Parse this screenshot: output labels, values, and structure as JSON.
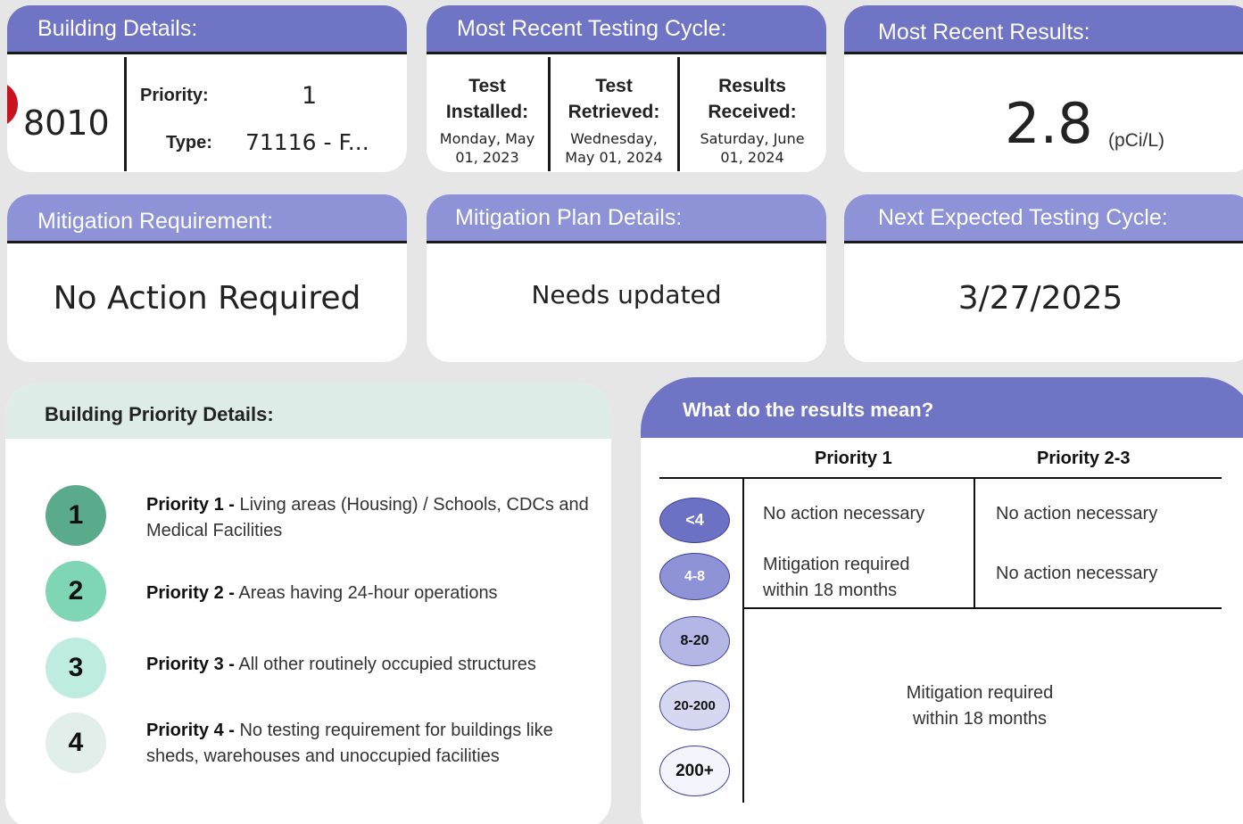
{
  "building": {
    "header": "Building Details:",
    "id": "8010",
    "priority_label": "Priority:",
    "priority_value": "1",
    "type_label": "Type:",
    "type_value": "71116 - F..."
  },
  "cycle": {
    "header": "Most Recent Testing Cycle:",
    "installed_label_1": "Test",
    "installed_label_2": "Installed:",
    "installed_date_1": "Monday, May",
    "installed_date_2": "01, 2023",
    "retrieved_label_1": "Test",
    "retrieved_label_2": "Retrieved:",
    "retrieved_date_1": "Wednesday,",
    "retrieved_date_2": "May 01, 2024",
    "received_label_1": "Results",
    "received_label_2": "Received:",
    "received_date_1": "Saturday, June",
    "received_date_2": "01, 2024"
  },
  "results": {
    "header": "Most Recent Results:",
    "value": "2.8",
    "unit": "(pCi/L)"
  },
  "mitigation_requirement": {
    "header": "Mitigation Requirement:",
    "value": "No Action Required"
  },
  "mitigation_plan": {
    "header": "Mitigation Plan Details:",
    "value": "Needs updated"
  },
  "next_cycle": {
    "header": "Next Expected Testing Cycle:",
    "value": "3/27/2025"
  },
  "priority_details": {
    "header": "Building Priority Details:",
    "items": [
      {
        "num": "1",
        "title": "Priority 1 -",
        "desc": "Living areas (Housing) / Schools, CDCs and Medical Facilities",
        "color": "#5aaa8c"
      },
      {
        "num": "2",
        "title": "Priority 2 -",
        "desc": "Areas having 24-hour operations",
        "color": "#7fd6b4"
      },
      {
        "num": "3",
        "title": "Priority 3 -",
        "desc": "All other routinely occupied structures",
        "color": "#bfece0"
      },
      {
        "num": "4",
        "title": "Priority 4 -",
        "desc": "No testing requirement for buildings like sheds, warehouses and unoccupied facilities",
        "color": "#e2eeea"
      }
    ]
  },
  "meaning": {
    "header": "What do the results mean?",
    "col1": "Priority 1",
    "col2": "Priority 2-3",
    "ranges": [
      {
        "label": "<4",
        "color": "#6d71c4",
        "text_color": "#ffffff"
      },
      {
        "label": "4-8",
        "color": "#8e92d6",
        "text_color": "#ffffff"
      },
      {
        "label": "8-20",
        "color": "#b4b7e6",
        "text_color": "#111111"
      },
      {
        "label": "20-200",
        "color": "#d6d8f2",
        "text_color": "#111111"
      },
      {
        "label": "200+",
        "color": "#f4f4fc",
        "text_color": "#111111"
      }
    ],
    "r1_p1": "No action necessary",
    "r1_p23": "No action necessary",
    "r2_p1_line1": "Mitigation required",
    "r2_p1_line2": "within 18 months",
    "r2_p23": "No action necessary",
    "r3_line1": "Mitigation required",
    "r3_line2": "within 18 months"
  },
  "colors": {
    "header_purple": "#7074c4",
    "header_light_purple": "#8e92d6",
    "priority_header": "#deece8",
    "background": "#e6e6e6",
    "alert_red": "#c8141e"
  }
}
